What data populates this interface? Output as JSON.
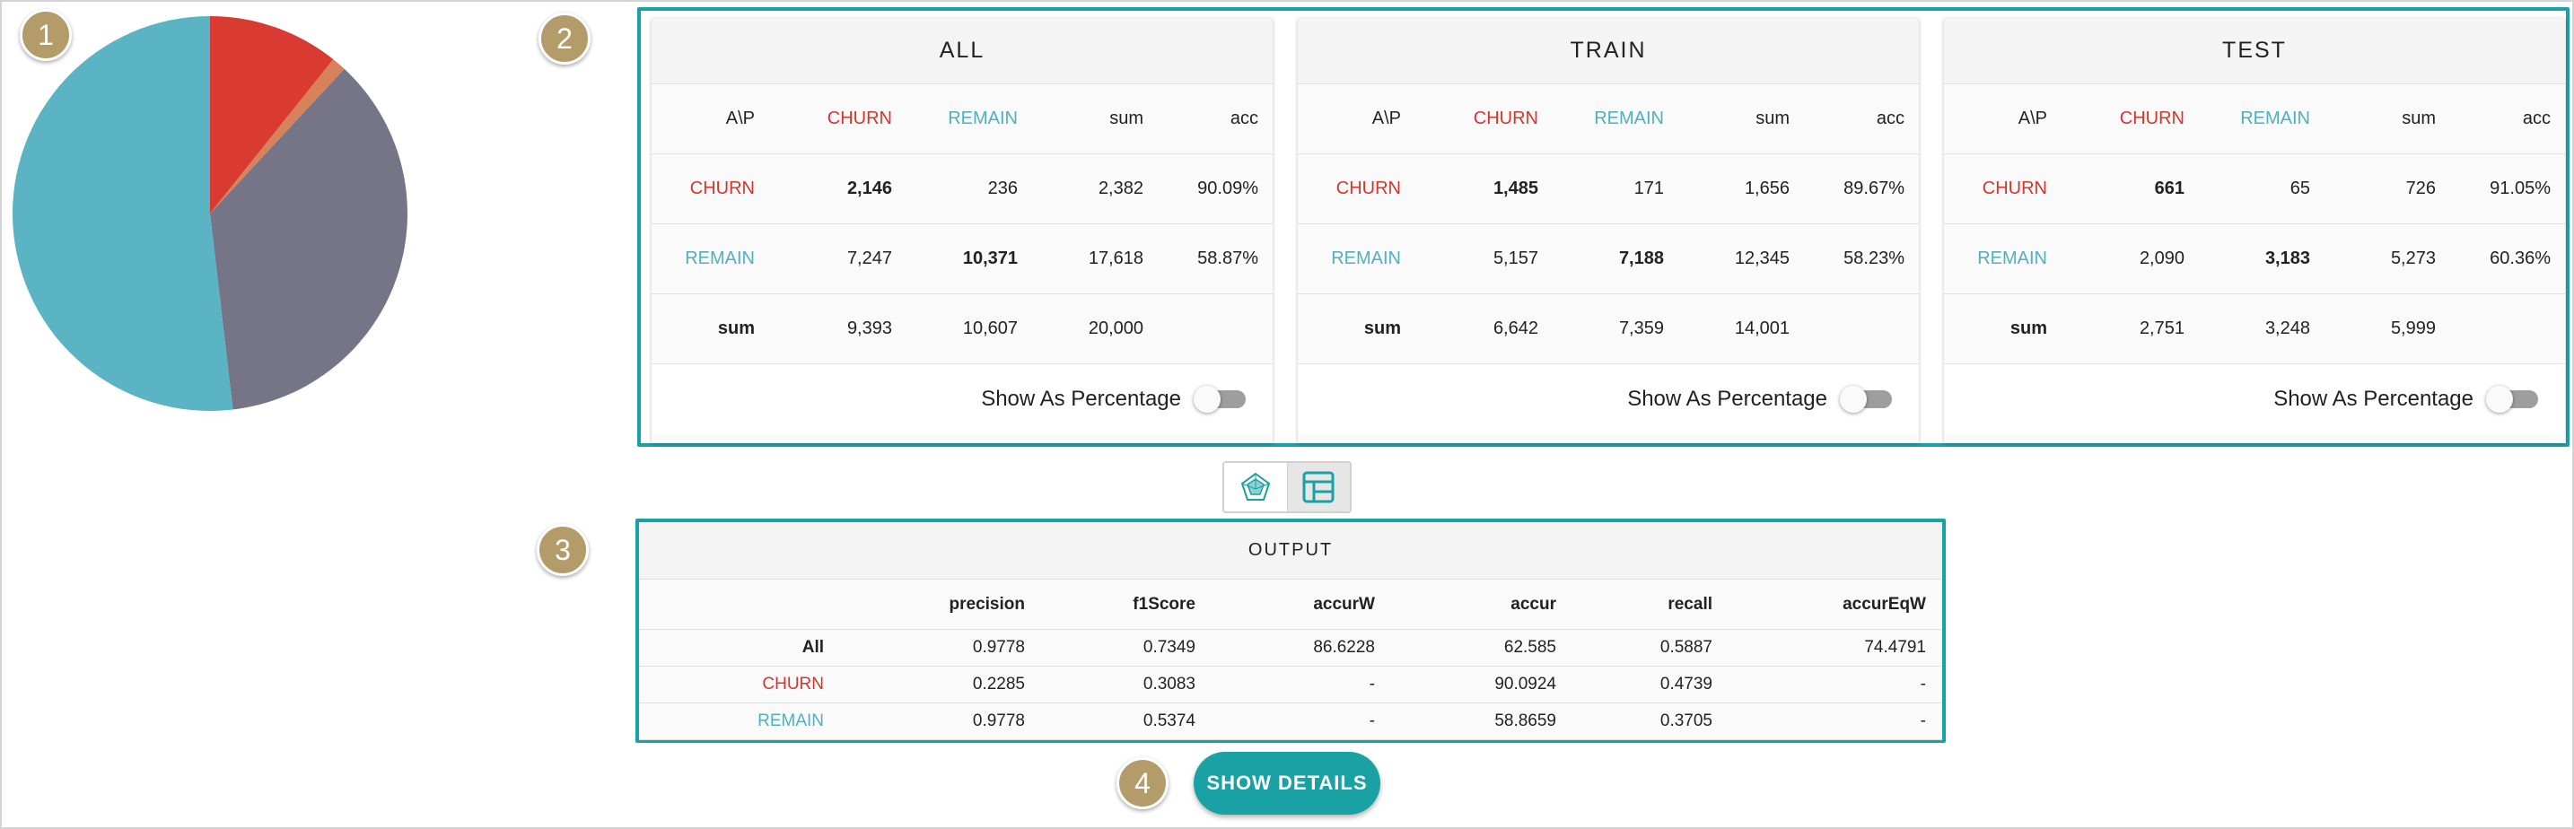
{
  "markers": [
    "1",
    "2",
    "3",
    "4"
  ],
  "colors": {
    "churn": "#d9342b",
    "remain": "#4fb0bf",
    "accent": "#1aa1a4",
    "pie_gray": "#767487",
    "pie_blue": "#5ab4c4",
    "pie_red": "#d93a32",
    "pie_orange": "#d7825a"
  },
  "pie": {
    "slices": [
      {
        "name": "pie-slice-churn-correct",
        "fraction": 0.1073,
        "color": "#d93a32"
      },
      {
        "name": "pie-slice-churn-missed",
        "fraction": 0.0118,
        "color": "#d7825a"
      },
      {
        "name": "pie-slice-remain-misclassified",
        "fraction": 0.3624,
        "color": "#767487"
      },
      {
        "name": "pie-slice-remain-correct",
        "fraction": 0.5185,
        "color": "#5ab4c4"
      }
    ]
  },
  "confusion": {
    "header": [
      "A\\P",
      "CHURN",
      "REMAIN",
      "sum",
      "acc"
    ],
    "toggle_label": "Show As Percentage",
    "panels": [
      {
        "title": "ALL",
        "churn_row": [
          "CHURN",
          "2,146",
          "236",
          "2,382",
          "90.09%"
        ],
        "remain_row": [
          "REMAIN",
          "7,247",
          "10,371",
          "17,618",
          "58.87%"
        ],
        "sum_row": [
          "sum",
          "9,393",
          "10,607",
          "20,000",
          ""
        ]
      },
      {
        "title": "TRAIN",
        "churn_row": [
          "CHURN",
          "1,485",
          "171",
          "1,656",
          "89.67%"
        ],
        "remain_row": [
          "REMAIN",
          "5,157",
          "7,188",
          "12,345",
          "58.23%"
        ],
        "sum_row": [
          "sum",
          "6,642",
          "7,359",
          "14,001",
          ""
        ]
      },
      {
        "title": "TEST",
        "churn_row": [
          "CHURN",
          "661",
          "65",
          "726",
          "91.05%"
        ],
        "remain_row": [
          "REMAIN",
          "2,090",
          "3,183",
          "5,273",
          "60.36%"
        ],
        "sum_row": [
          "sum",
          "2,751",
          "3,248",
          "5,999",
          ""
        ]
      }
    ]
  },
  "view_switch": {
    "icons": [
      "radar-chart-icon",
      "table-icon"
    ],
    "active": "table-icon"
  },
  "output": {
    "title": "OUTPUT",
    "headers": [
      "",
      "precision",
      "f1Score",
      "accurW",
      "accur",
      "recall",
      "accurEqW"
    ],
    "rows": [
      [
        "All",
        "0.9778",
        "0.7349",
        "86.6228",
        "62.585",
        "0.5887",
        "74.4791"
      ],
      [
        "CHURN",
        "0.2285",
        "0.3083",
        "-",
        "90.0924",
        "0.4739",
        "-"
      ],
      [
        "REMAIN",
        "0.9778",
        "0.5374",
        "-",
        "58.8659",
        "0.3705",
        "-"
      ]
    ]
  },
  "show_details_label": "SHOW DETAILS"
}
